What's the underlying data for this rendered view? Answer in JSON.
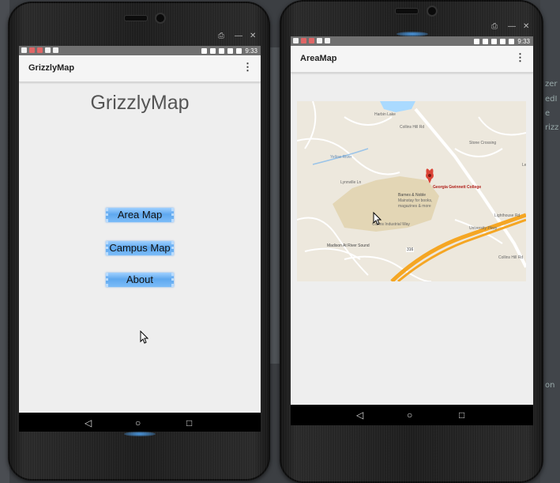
{
  "left_device": {
    "window_controls": [
      "⎙",
      "—",
      "✕"
    ],
    "status_time": "9:33",
    "app_title": "GrizzlyMap",
    "overflow_icon": "more-vert-icon",
    "main_title": "GrizzlyMap",
    "buttons": [
      {
        "label": "Area Map"
      },
      {
        "label": "Campus Map"
      },
      {
        "label": "About"
      }
    ],
    "nav": {
      "back": "◁",
      "home": "○",
      "recents": "□"
    }
  },
  "right_device": {
    "window_controls": [
      "⎙",
      "—",
      "✕"
    ],
    "status_time": "9:33",
    "app_title": "AreaMap",
    "overflow_icon": "more-vert-icon",
    "map": {
      "labels": {
        "lake": "Harbin Lake",
        "road1": "Collins Hill Rd",
        "road2": "Yellow River",
        "college": "Georgia Gwinnett College",
        "poi": "Barnes & Noble",
        "poi_desc1": "Mainstay for books,",
        "poi_desc2": "magazines & more",
        "road3": "Collins Industrial Way",
        "road4": "University Pkwy",
        "road5": "Madison At River Sound",
        "road6": "Lighthouse Rd",
        "route": "316",
        "road7": "Collins Hill Rd",
        "road8": "Stone Crossing",
        "road9": "Lynnville Ln",
        "road10": "Le"
      },
      "colors": {
        "highway": "#f5a623",
        "campus": "#e8ddc1",
        "water": "#aadaff",
        "pin": "#db4437"
      }
    },
    "nav": {
      "back": "◁",
      "home": "○",
      "recents": "□"
    }
  },
  "ide_side": {
    "labels": [
      "zer",
      "edI",
      "e",
      "rizz",
      "on"
    ]
  }
}
